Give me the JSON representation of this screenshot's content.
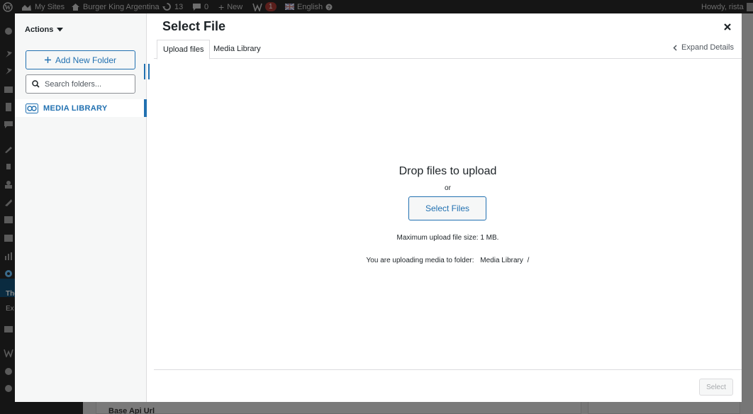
{
  "adminbar": {
    "my_sites": "My Sites",
    "site_name": "Burger King Argentina",
    "updates_count": "13",
    "comments_count": "0",
    "new_label": "New",
    "plugin_count": "1",
    "language": "English",
    "greeting": "Howdy, rista"
  },
  "background": {
    "menu_text_1": "The",
    "menu_text_2": "Ex",
    "content_label": "Base Api Url"
  },
  "modal": {
    "title": "Select File",
    "close_label": "×",
    "tabs": [
      {
        "label": "Upload files",
        "active": true
      },
      {
        "label": "Media Library",
        "active": false
      }
    ],
    "expand_details": "Expand Details",
    "select_button": "Select"
  },
  "folders": {
    "actions_label": "Actions",
    "add_folder_label": "Add New Folder",
    "search_placeholder": "Search folders...",
    "media_library_label": "MEDIA LIBRARY"
  },
  "uploader": {
    "drop_title": "Drop files to upload",
    "or_text": "or",
    "select_files_label": "Select Files",
    "max_size_text": "Maximum upload file size: 1 MB.",
    "target_prefix": "You are uploading media to folder:",
    "target_folder": "Media Library",
    "target_slash": "/"
  },
  "colors": {
    "accent": "#2271b1",
    "admin_bar": "#151515",
    "overlay_bg": "#767676"
  }
}
